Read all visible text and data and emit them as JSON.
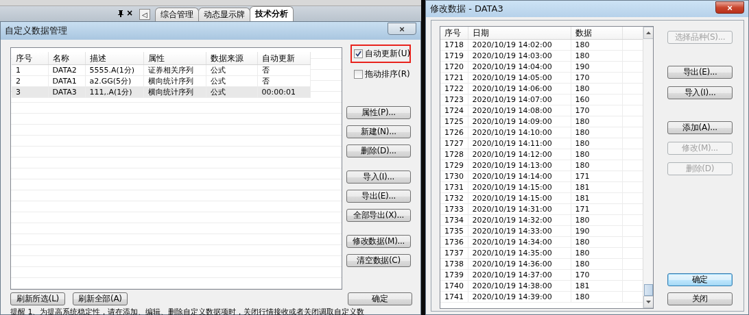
{
  "panel": {
    "close": "×",
    "tab_scroll": "◁",
    "tabs": [
      {
        "label": "综合管理",
        "selected": false
      },
      {
        "label": "动态显示牌",
        "selected": false
      },
      {
        "label": "技术分析",
        "selected": true
      }
    ]
  },
  "custom_data_dialog": {
    "title": "自定义数据管理",
    "close": "×",
    "table": {
      "columns": [
        "序号",
        "名称",
        "描述",
        "属性",
        "数据来源",
        "自动更新"
      ],
      "rows": [
        {
          "cells": [
            "1",
            "DATA2",
            "5555.A(1分)",
            "证券相关序列",
            "公式",
            "否"
          ],
          "selected": false
        },
        {
          "cells": [
            "2",
            "DATA1",
            "a2.GG(5分)",
            "横向统计序列",
            "公式",
            "否"
          ],
          "selected": false
        },
        {
          "cells": [
            "3",
            "DATA3",
            "111,.A(1分)",
            "横向统计序列",
            "公式",
            "00:00:01"
          ],
          "selected": true
        }
      ]
    },
    "options": [
      {
        "label": "自动更新(U)",
        "checked": true,
        "highlighted": true
      },
      {
        "label": "拖动排序(R)",
        "checked": false,
        "highlighted": false
      }
    ],
    "side_button_groups": [
      [
        "属性(P)...",
        "新建(N)...",
        "删除(D)..."
      ],
      [
        "导入(I)...",
        "导出(E)...",
        "全部导出(X)..."
      ],
      [
        "修改数据(M)...",
        "清空数据(C)"
      ]
    ],
    "bottom_buttons": [
      "刷新所选(L)",
      "刷新全部(A)"
    ],
    "ok_button": "确定",
    "note": "提醒 1、为提高系统稳定性，请在添加、编辑、删除自定义数据项时，关闭行情接收或者关闭调取自定义数"
  },
  "edit_data_dialog": {
    "title": "修改数据 - DATA3",
    "close": "×",
    "table": {
      "columns": [
        "序号",
        "日期",
        "数据"
      ],
      "rows": [
        [
          "1718",
          "2020/10/19 14:02:00",
          "180"
        ],
        [
          "1719",
          "2020/10/19 14:03:00",
          "180"
        ],
        [
          "1720",
          "2020/10/19 14:04:00",
          "190"
        ],
        [
          "1721",
          "2020/10/19 14:05:00",
          "170"
        ],
        [
          "1722",
          "2020/10/19 14:06:00",
          "180"
        ],
        [
          "1723",
          "2020/10/19 14:07:00",
          "160"
        ],
        [
          "1724",
          "2020/10/19 14:08:00",
          "170"
        ],
        [
          "1725",
          "2020/10/19 14:09:00",
          "180"
        ],
        [
          "1726",
          "2020/10/19 14:10:00",
          "180"
        ],
        [
          "1727",
          "2020/10/19 14:11:00",
          "180"
        ],
        [
          "1728",
          "2020/10/19 14:12:00",
          "180"
        ],
        [
          "1729",
          "2020/10/19 14:13:00",
          "180"
        ],
        [
          "1730",
          "2020/10/19 14:14:00",
          "171"
        ],
        [
          "1731",
          "2020/10/19 14:15:00",
          "181"
        ],
        [
          "1732",
          "2020/10/19 14:15:00",
          "181"
        ],
        [
          "1733",
          "2020/10/19 14:31:00",
          "171"
        ],
        [
          "1734",
          "2020/10/19 14:32:00",
          "180"
        ],
        [
          "1735",
          "2020/10/19 14:33:00",
          "190"
        ],
        [
          "1736",
          "2020/10/19 14:34:00",
          "180"
        ],
        [
          "1737",
          "2020/10/19 14:35:00",
          "180"
        ],
        [
          "1738",
          "2020/10/19 14:36:00",
          "180"
        ],
        [
          "1739",
          "2020/10/19 14:37:00",
          "170"
        ],
        [
          "1740",
          "2020/10/19 14:38:00",
          "181"
        ],
        [
          "1741",
          "2020/10/19 14:39:00",
          "180"
        ]
      ]
    },
    "button_groups": [
      [
        {
          "label": "选择品种(S)...",
          "disabled": true,
          "default": false
        }
      ],
      [
        {
          "label": "导出(E)...",
          "disabled": false,
          "default": false
        },
        {
          "label": "导入(I)...",
          "disabled": false,
          "default": false
        }
      ],
      [
        {
          "label": "添加(A)...",
          "disabled": false,
          "default": false
        },
        {
          "label": "修改(M)...",
          "disabled": true,
          "default": false
        },
        {
          "label": "删除(D)",
          "disabled": true,
          "default": false
        }
      ]
    ],
    "bottom_buttons": [
      {
        "label": "确定",
        "disabled": false,
        "default": true
      },
      {
        "label": "关闭",
        "disabled": false,
        "default": false
      }
    ]
  }
}
